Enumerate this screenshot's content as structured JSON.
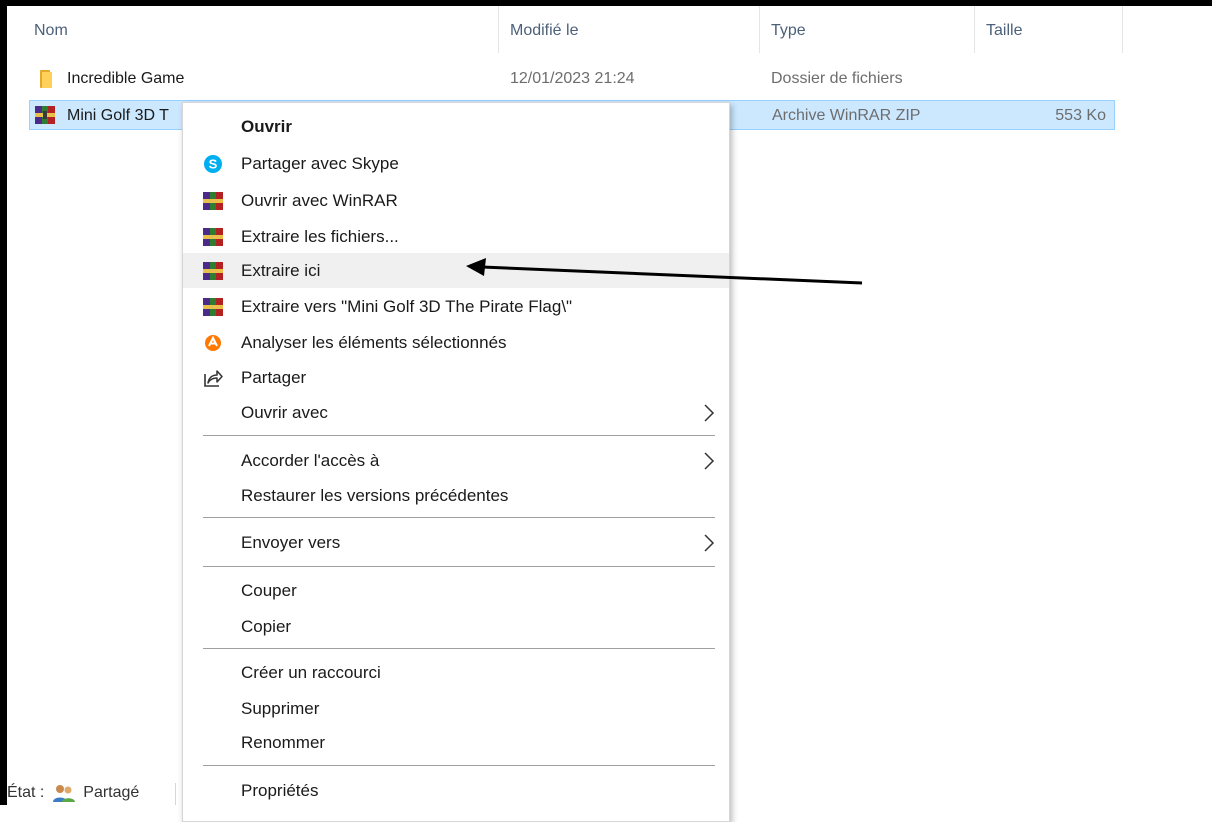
{
  "columns": {
    "name": "Nom",
    "modified": "Modifié le",
    "type": "Type",
    "size": "Taille"
  },
  "files": [
    {
      "name": "Incredible Game",
      "modified": "12/01/2023 21:24",
      "type": "Dossier de fichiers",
      "size": "",
      "icon": "folder-icon"
    },
    {
      "name": "Mini Golf 3D T",
      "modified": "",
      "type": "Archive WinRAR ZIP",
      "size": "553 Ko",
      "icon": "winrar-archive-icon",
      "selected": true
    }
  ],
  "context_menu": {
    "open": "Ouvrir",
    "share_skype": "Partager avec Skype",
    "open_winrar": "Ouvrir avec WinRAR",
    "extract_files": "Extraire les fichiers...",
    "extract_here": "Extraire ici",
    "extract_to": "Extraire vers \"Mini Golf 3D The Pirate Flag\\\"",
    "scan": "Analyser les éléments sélectionnés",
    "share": "Partager",
    "open_with": "Ouvrir avec",
    "grant_access": "Accorder l'accès à",
    "restore_versions": "Restaurer les versions précédentes",
    "send_to": "Envoyer vers",
    "cut": "Couper",
    "copy": "Copier",
    "create_shortcut": "Créer un raccourci",
    "delete": "Supprimer",
    "rename": "Renommer",
    "properties": "Propriétés"
  },
  "status_bar": {
    "state_label": "État :",
    "state_value": "Partagé"
  },
  "colors": {
    "selection_bg": "#cce8ff",
    "selection_border": "#99d1ff",
    "hover_bg": "#f0f0f0",
    "header_text": "#4c607a",
    "skype_blue": "#00aff0",
    "avast_orange": "#ff7800"
  }
}
